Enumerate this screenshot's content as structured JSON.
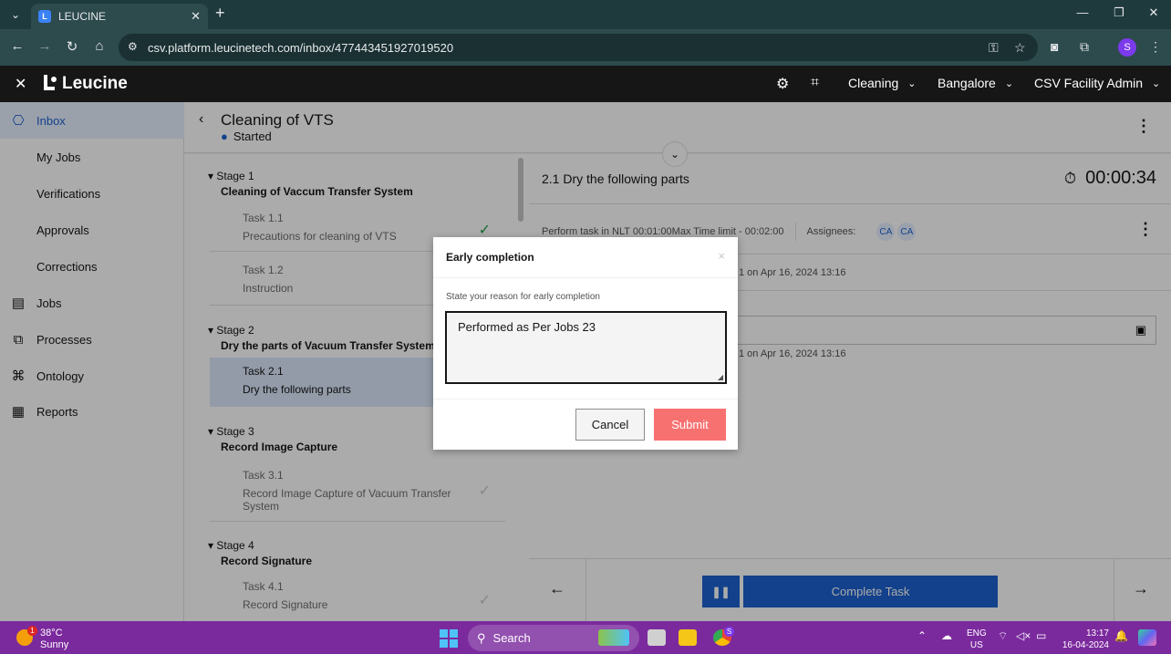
{
  "browser": {
    "tab_title": "LEUCINE",
    "url": "csv.platform.leucinetech.com/inbox/477443451927019520",
    "profile_initial": "S",
    "colors": {
      "chrome": "#2d4a4d",
      "profile": "#7c3aed"
    }
  },
  "header": {
    "brand": "Leucine",
    "use_case": "Cleaning",
    "facility": "Bangalore",
    "user_role": "CSV Facility Admin"
  },
  "sidebar": {
    "items": [
      {
        "label": "Inbox",
        "icon": "inbox-icon"
      },
      {
        "label": "My Jobs"
      },
      {
        "label": "Verifications"
      },
      {
        "label": "Approvals"
      },
      {
        "label": "Corrections"
      },
      {
        "label": "Jobs",
        "icon": "clipboard-icon"
      },
      {
        "label": "Processes",
        "icon": "flow-icon"
      },
      {
        "label": "Ontology",
        "icon": "hierarchy-icon"
      },
      {
        "label": "Reports",
        "icon": "report-icon"
      }
    ]
  },
  "process": {
    "title": "Cleaning of VTS",
    "status": "Started"
  },
  "stages": [
    {
      "label": "Stage 1",
      "name": "Cleaning of Vaccum Transfer System",
      "tasks": [
        {
          "num": "Task 1.1",
          "name": "Precautions for cleaning of VTS"
        },
        {
          "num": "Task 1.2",
          "name": "Instruction"
        }
      ]
    },
    {
      "label": "Stage 2",
      "name": "Dry the parts of Vacuum Transfer System",
      "tasks": [
        {
          "num": "Task 2.1",
          "name": "Dry the following parts"
        }
      ]
    },
    {
      "label": "Stage 3",
      "name": "Record Image Capture",
      "tasks": [
        {
          "num": "Task 3.1",
          "name": "Record Image Capture of Vacuum Transfer System"
        }
      ]
    },
    {
      "label": "Stage 4",
      "name": "Record Signature",
      "tasks": [
        {
          "num": "Task 4.1",
          "name": "Record Signature"
        }
      ]
    }
  ],
  "task": {
    "title": "2.1 Dry the following parts",
    "timer": "00:00:34",
    "meta": "Perform task in NLT 00:01:00Max Time limit - 00:02:00",
    "assignees_label": "Assignees:",
    "assignees": [
      "CA",
      "CA"
    ],
    "note_1": "1 on Apr 16, 2024 13:16",
    "note_2": "1 on Apr 16, 2024 13:16",
    "complete_label": "Complete Task"
  },
  "modal": {
    "title": "Early completion",
    "close": "×",
    "prompt": "State your reason for early completion",
    "reason": "Performed as Per Jobs 23",
    "cancel": "Cancel",
    "submit": "Submit",
    "colors": {
      "submit": "#f87171"
    }
  },
  "taskbar": {
    "temp": "38°C",
    "weather": "Sunny",
    "weather_badge": "1",
    "search": "Search",
    "lang_1": "ENG",
    "lang_2": "US",
    "time": "13:17",
    "date": "16-04-2024",
    "chrome_badge": "S"
  }
}
